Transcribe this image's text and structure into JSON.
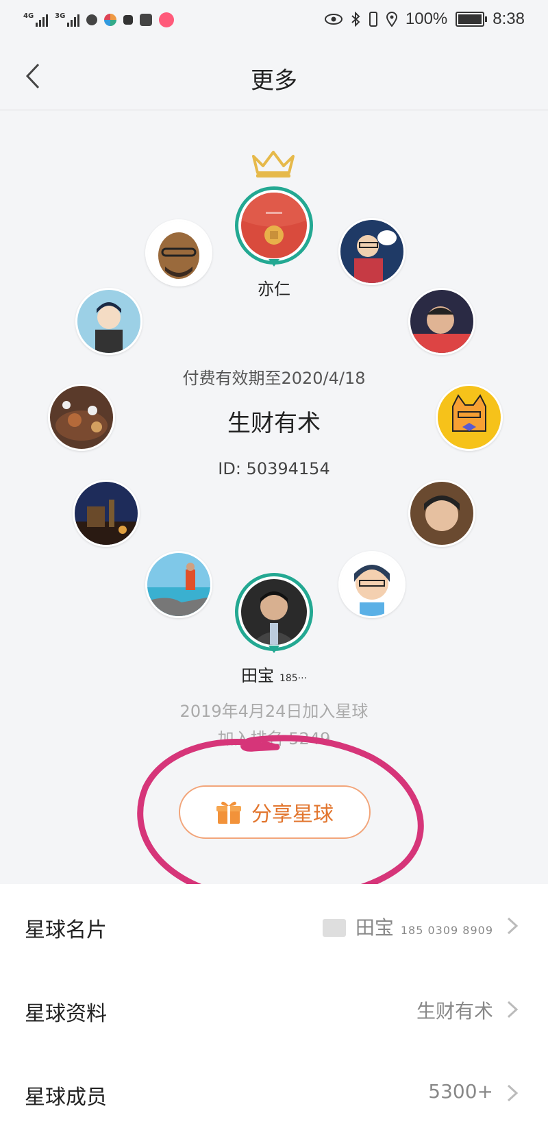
{
  "status_bar": {
    "net1": "4G",
    "net2": "3G",
    "battery_pct": "100%",
    "time": "8:38"
  },
  "nav": {
    "title": "更多",
    "back_icon": "chevron-left-icon"
  },
  "circle": {
    "owner_name": "亦仁",
    "paid_until": "付费有效期至2020/4/18",
    "group_name": "生财有术",
    "group_id": "ID: 50394154",
    "member_name": "田宝",
    "member_phone_short": "185···",
    "joined": "2019年4月24日加入星球",
    "join_rank": "加入排名 5249",
    "crown_icon": "crown-icon"
  },
  "share": {
    "label": "分享星球",
    "icon": "gift-icon"
  },
  "list": {
    "card": {
      "label": "星球名片",
      "name": "田宝",
      "phone": "185 0309 8909"
    },
    "profile": {
      "label": "星球资料",
      "value": "生财有术"
    },
    "members": {
      "label": "星球成员",
      "value": "5300+"
    }
  },
  "colors": {
    "accent_green": "#23a892",
    "share_orange": "#e2762f",
    "annotation_pink": "#d63579"
  }
}
